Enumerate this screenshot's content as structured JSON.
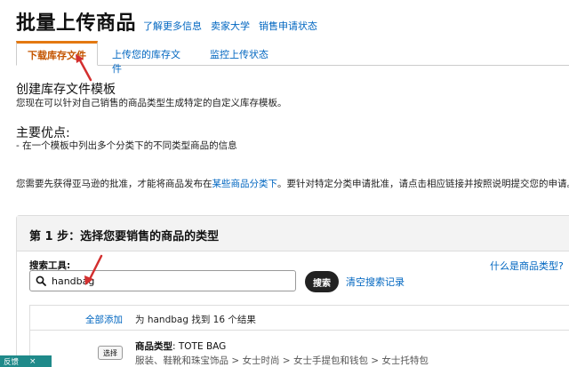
{
  "header": {
    "title": "批量上传商品",
    "links": [
      "了解更多信息",
      "卖家大学",
      "销售申请状态"
    ]
  },
  "tabs": [
    "下载库存文件",
    "上传您的库存文件",
    "监控上传状态"
  ],
  "create": {
    "title": "创建库存文件模板",
    "desc": "您现在可以针对自己销售的商品类型生成特定的自定义库存模板。"
  },
  "advantages": {
    "title": "主要优点:",
    "item": "- 在一个模板中列出多个分类下的不同类型商品的信息"
  },
  "notice": {
    "before": "您需要先获得亚马逊的批准，才能将商品发布在",
    "link": "某些商品分类下",
    "after": "。要针对特定分类申请批准，请点击相应链接并按照说明提交您的申请。"
  },
  "step1": {
    "title": "第 1 步：选择您要销售的商品的类型",
    "search_label": "搜索工具:",
    "search_value": "handbag",
    "search_button": "搜索",
    "clear_link": "清空搜索记录",
    "what_link": "什么是商品类型?"
  },
  "results": {
    "add_all": "全部添加",
    "count_text": "为 handbag 找到 16 个结果",
    "items": [
      {
        "select_label": "选择",
        "type_label": "商品类型",
        "type_value": ": TOTE BAG",
        "path": "服装、鞋靴和珠宝饰品 > 女士时尚 > 女士手提包和钱包 > 女士托特包"
      }
    ]
  },
  "feedback": {
    "label": "反馈",
    "close": "×"
  },
  "colors": {
    "link": "#0066c0",
    "tab_accent": "#e47911",
    "annotation_arrow": "#d32f2f",
    "search_button_bg": "#222222",
    "feedback_bg": "#1f8a8a"
  }
}
